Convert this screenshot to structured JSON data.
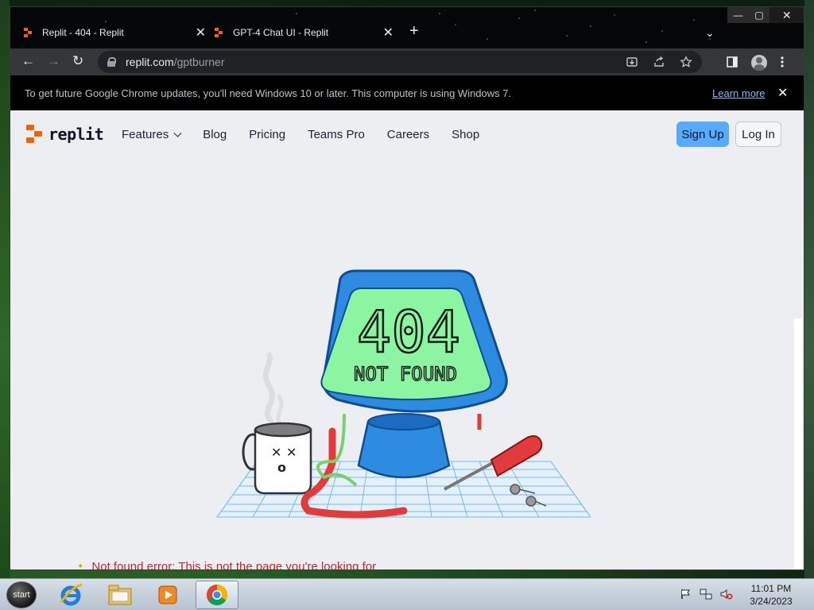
{
  "browser": {
    "tabs": [
      {
        "title": "Replit - 404 - Replit",
        "close": "✕"
      },
      {
        "title": "GPT-4 Chat UI - Replit",
        "close": "✕"
      }
    ],
    "new_tab": "+",
    "tab_menu": "⌄",
    "window_controls": {
      "minimize": "—",
      "maximize": "▢",
      "close": "✕"
    },
    "nav": {
      "back": "←",
      "forward": "→",
      "reload": "↻"
    },
    "url": {
      "host": "replit.com",
      "path": "/gptburner"
    },
    "infobar": {
      "message": "To get future Google Chrome updates, you'll need Windows 10 or later. This computer is using Windows 7.",
      "link": "Learn more",
      "close": "✕"
    }
  },
  "site": {
    "logo_text": "replit",
    "nav_links": [
      "Features",
      "Blog",
      "Pricing",
      "Teams Pro",
      "Careers",
      "Shop"
    ],
    "signup": "Sign Up",
    "login": "Log In",
    "illustration": {
      "line1": "404",
      "line2": "NOT FOUND"
    },
    "footer_message": "Not found error: This is not the page you're looking for"
  },
  "taskbar": {
    "start": "start",
    "time": "11:01 PM",
    "date": "3/24/2023"
  },
  "colors": {
    "replit_orange": "#f26207",
    "signup_blue": "#57abff",
    "error_red": "#c6252f",
    "screen_green": "#8cf5a1",
    "monitor_blue": "#1f7bd8"
  }
}
